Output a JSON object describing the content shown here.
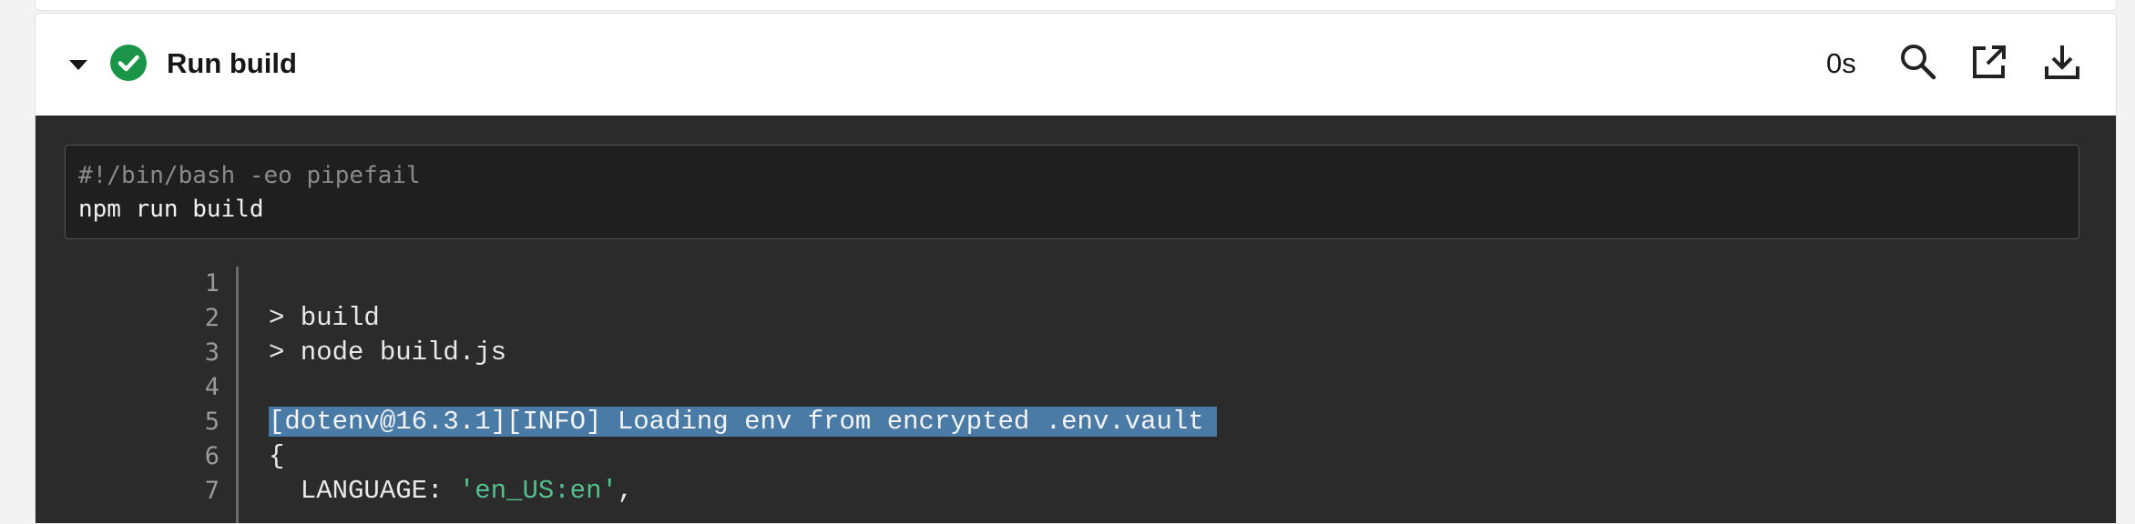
{
  "step": {
    "title": "Run build",
    "duration": "0s",
    "status": "success",
    "status_color": "#1a9547",
    "icons": [
      "caret-down-icon",
      "success-check-icon",
      "search-icon",
      "open-new-window-icon",
      "download-icon"
    ]
  },
  "command": {
    "shebang": "#!/bin/bash -eo pipefail",
    "line": "npm run build"
  },
  "log": {
    "lines": [
      {
        "n": "1",
        "text": ""
      },
      {
        "n": "2",
        "text": "> build"
      },
      {
        "n": "3",
        "text": "> node build.js"
      },
      {
        "n": "4",
        "text": ""
      },
      {
        "n": "5",
        "text": "[dotenv@16.3.1][INFO] Loading env from encrypted .env.vault"
      },
      {
        "n": "6",
        "text": "{"
      },
      {
        "n": "7",
        "key": "  LANGUAGE: ",
        "value": "'en_US:en'",
        "suffix": ","
      }
    ]
  }
}
